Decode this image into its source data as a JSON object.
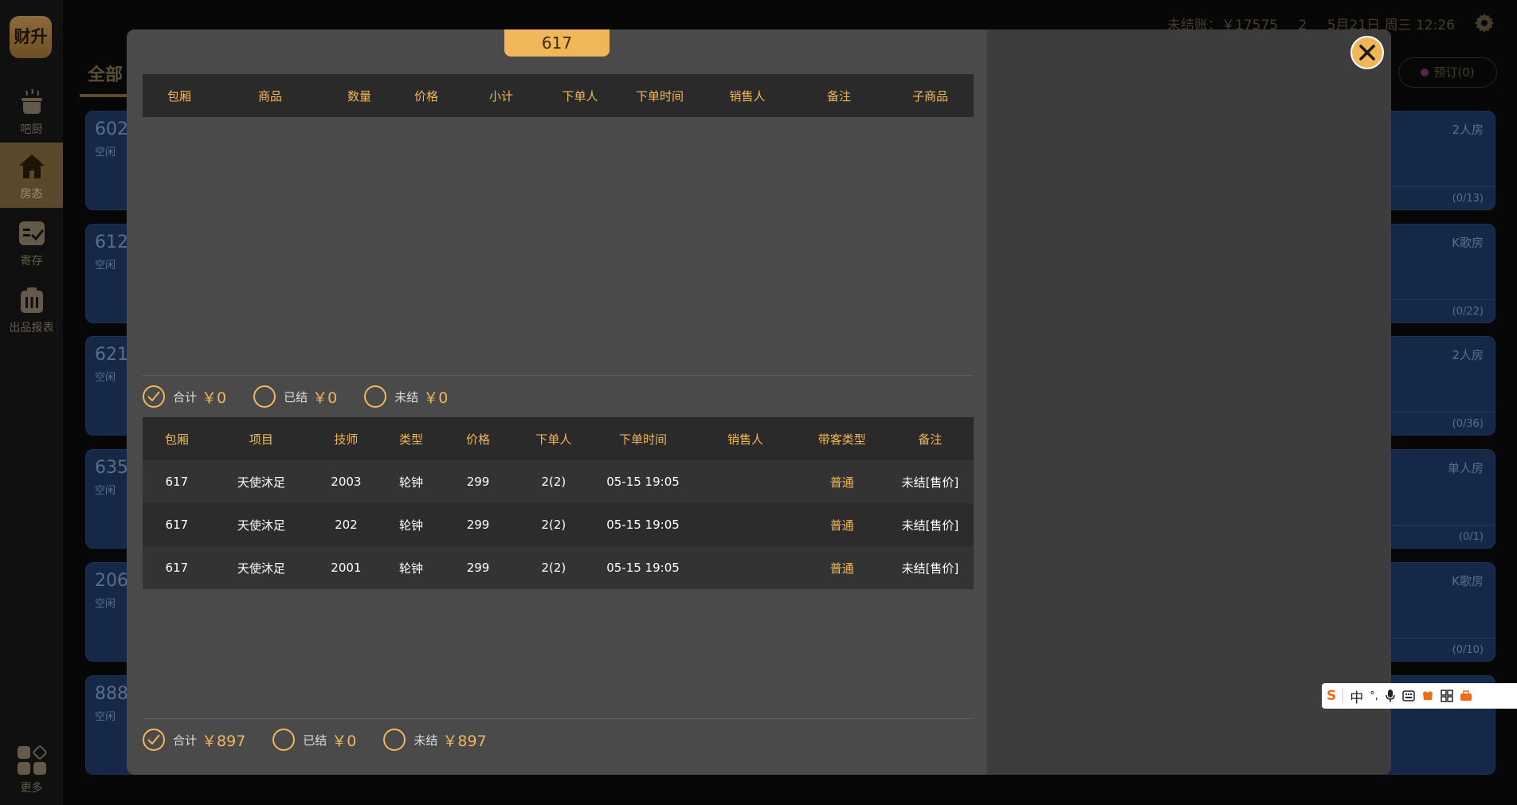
{
  "app": {
    "logo_text": "财升"
  },
  "sidebar": {
    "items": [
      {
        "label": "吧厨",
        "icon": "pot-icon"
      },
      {
        "label": "房态",
        "icon": "home-icon",
        "active": true
      },
      {
        "label": "寄存",
        "icon": "storage-check-icon"
      },
      {
        "label": "出品报表",
        "icon": "report-icon"
      }
    ],
    "more_label": "更多"
  },
  "topbar": {
    "unsettled": "未结账：￥17575",
    "count": "2",
    "datetime": "5月21日 周三 12:26"
  },
  "main": {
    "tab_all": "全部",
    "booking_label": "预订(0)"
  },
  "rooms": [
    {
      "num": "602",
      "state": "空闲",
      "type": "2人房",
      "count": "(0/13)"
    },
    {
      "num": "612",
      "state": "空闲",
      "type": "K歌房",
      "count": "(0/22)"
    },
    {
      "num": "621",
      "state": "空闲",
      "type": "2人房",
      "count": "(0/36)"
    },
    {
      "num": "635",
      "state": "空闲",
      "type": "单人房",
      "count": "(0/1)"
    },
    {
      "num": "206",
      "state": "空闲",
      "type": "K歌房",
      "count": "(0/10)"
    },
    {
      "num": "888",
      "state": "空闲",
      "type": "",
      "count": ""
    }
  ],
  "modal": {
    "room_tab": "617",
    "goods_table": {
      "headers": [
        "包厢",
        "商品",
        "数量",
        "价格",
        "小计",
        "下单人",
        "下单时间",
        "销售人",
        "备注",
        "子商品"
      ],
      "rows": []
    },
    "goods_summary": {
      "total_label": "合计",
      "total": "￥0",
      "settled_label": "已结",
      "settled": "￥0",
      "unsettled_label": "未结",
      "unsettled": "￥0"
    },
    "service_table": {
      "headers": [
        "包厢",
        "项目",
        "技师",
        "类型",
        "价格",
        "下单人",
        "下单时间",
        "销售人",
        "带客类型",
        "备注"
      ],
      "rows": [
        [
          "617",
          "天使沐足",
          "2003",
          "轮钟",
          "299",
          "2(2)",
          "05-15 19:05",
          "",
          "普通",
          "未结[售价]"
        ],
        [
          "617",
          "天使沐足",
          "202",
          "轮钟",
          "299",
          "2(2)",
          "05-15 19:05",
          "",
          "普通",
          "未结[售价]"
        ],
        [
          "617",
          "天使沐足",
          "2001",
          "轮钟",
          "299",
          "2(2)",
          "05-15 19:05",
          "",
          "普通",
          "未结[售价]"
        ]
      ]
    },
    "service_summary": {
      "total_label": "合计",
      "total": "￥897",
      "settled_label": "已结",
      "settled": "￥0",
      "unsettled_label": "未结",
      "unsettled": "￥897"
    }
  },
  "ime": {
    "items": [
      "中",
      "°,",
      "mic",
      "keyboard",
      "skin",
      "grid",
      "tool"
    ]
  },
  "colors": {
    "accent": "#f1b658",
    "card": "#223e6f",
    "panel": "#4a4a4a"
  }
}
